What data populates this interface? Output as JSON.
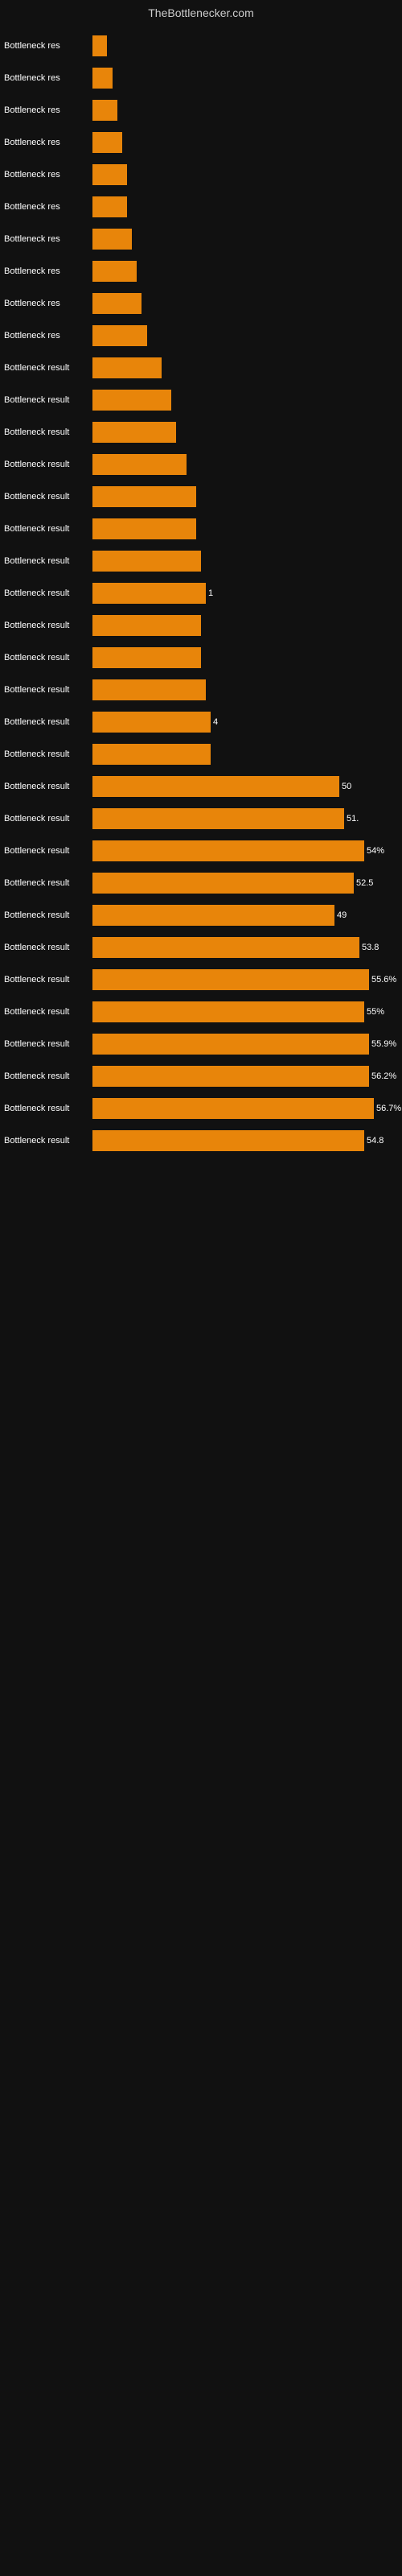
{
  "header": {
    "title": "TheBottlenecker.com"
  },
  "chart": {
    "max_width": 350,
    "bars": [
      {
        "label": "Bottleneck res",
        "value": null,
        "display": "",
        "width_pct": 3
      },
      {
        "label": "Bottleneck res",
        "value": null,
        "display": "",
        "width_pct": 4
      },
      {
        "label": "Bottleneck res",
        "value": null,
        "display": "",
        "width_pct": 5
      },
      {
        "label": "Bottleneck res",
        "value": null,
        "display": "",
        "width_pct": 6
      },
      {
        "label": "Bottleneck res",
        "value": null,
        "display": "",
        "width_pct": 7
      },
      {
        "label": "Bottleneck res",
        "value": null,
        "display": "",
        "width_pct": 7
      },
      {
        "label": "Bottleneck res",
        "value": null,
        "display": "",
        "width_pct": 8
      },
      {
        "label": "Bottleneck res",
        "value": null,
        "display": "",
        "width_pct": 9
      },
      {
        "label": "Bottleneck res",
        "value": null,
        "display": "",
        "width_pct": 10
      },
      {
        "label": "Bottleneck res",
        "value": null,
        "display": "",
        "width_pct": 11
      },
      {
        "label": "Bottleneck result",
        "value": null,
        "display": "",
        "width_pct": 14
      },
      {
        "label": "Bottleneck result",
        "value": null,
        "display": "",
        "width_pct": 16
      },
      {
        "label": "Bottleneck result",
        "value": null,
        "display": "",
        "width_pct": 17
      },
      {
        "label": "Bottleneck result",
        "value": null,
        "display": "",
        "width_pct": 19
      },
      {
        "label": "Bottleneck result",
        "value": null,
        "display": "",
        "width_pct": 21
      },
      {
        "label": "Bottleneck result",
        "value": null,
        "display": "",
        "width_pct": 21
      },
      {
        "label": "Bottleneck result",
        "value": null,
        "display": "",
        "width_pct": 22
      },
      {
        "label": "Bottleneck result",
        "value": null,
        "display": "1",
        "width_pct": 23
      },
      {
        "label": "Bottleneck result",
        "value": null,
        "display": "",
        "width_pct": 22
      },
      {
        "label": "Bottleneck result",
        "value": null,
        "display": "",
        "width_pct": 22
      },
      {
        "label": "Bottleneck result",
        "value": null,
        "display": "",
        "width_pct": 23
      },
      {
        "label": "Bottleneck result",
        "value": null,
        "display": "4",
        "width_pct": 24
      },
      {
        "label": "Bottleneck result",
        "value": null,
        "display": "",
        "width_pct": 24
      },
      {
        "label": "Bottleneck result",
        "value": "50",
        "display": "50",
        "width_pct": 50
      },
      {
        "label": "Bottleneck result",
        "value": "51",
        "display": "51.",
        "width_pct": 51
      },
      {
        "label": "Bottleneck result",
        "value": "54.8",
        "display": "54%",
        "width_pct": 55
      },
      {
        "label": "Bottleneck result",
        "value": "52.5",
        "display": "52.5",
        "width_pct": 53
      },
      {
        "label": "Bottleneck result",
        "value": "49",
        "display": "49",
        "width_pct": 49
      },
      {
        "label": "Bottleneck result",
        "value": "53.8",
        "display": "53.8",
        "width_pct": 54
      },
      {
        "label": "Bottleneck result",
        "value": "55.6",
        "display": "55.6%",
        "width_pct": 56
      },
      {
        "label": "Bottleneck result",
        "value": "55",
        "display": "55%",
        "width_pct": 55
      },
      {
        "label": "Bottleneck result",
        "value": "55.9",
        "display": "55.9%",
        "width_pct": 56
      },
      {
        "label": "Bottleneck result",
        "value": "56.2",
        "display": "56.2%",
        "width_pct": 56
      },
      {
        "label": "Bottleneck result",
        "value": "56.7",
        "display": "56.7%",
        "width_pct": 57
      },
      {
        "label": "Bottleneck result",
        "value": "54.8",
        "display": "54.8",
        "width_pct": 55
      }
    ]
  }
}
